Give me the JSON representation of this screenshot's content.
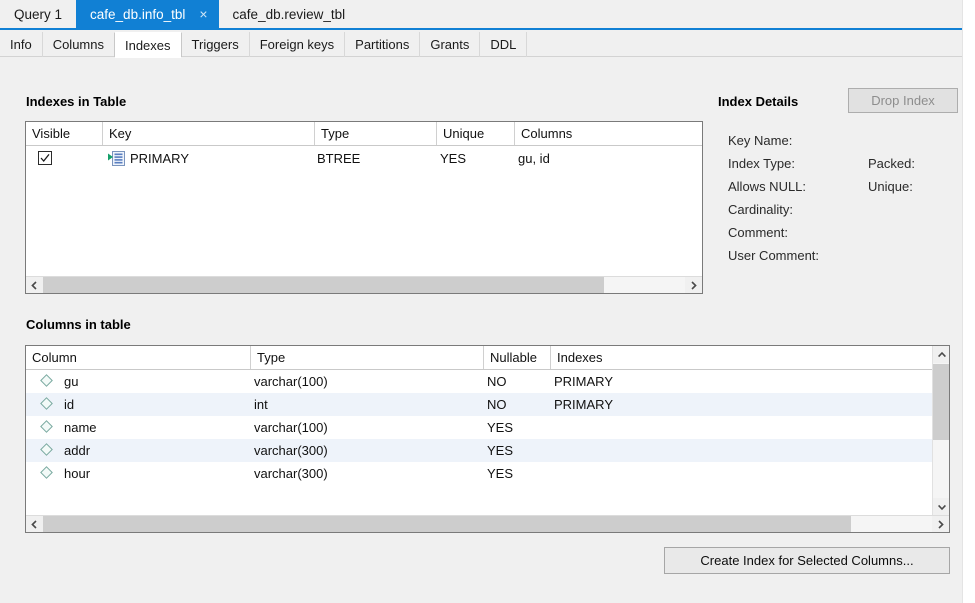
{
  "editor_tabs": [
    {
      "label": "Query 1",
      "active": false,
      "closable": false
    },
    {
      "label": "cafe_db.info_tbl",
      "active": true,
      "closable": true,
      "close_glyph": "×"
    },
    {
      "label": "cafe_db.review_tbl",
      "active": false,
      "closable": false
    }
  ],
  "object_tabs": [
    {
      "label": "Info",
      "active": false
    },
    {
      "label": "Columns",
      "active": false
    },
    {
      "label": "Indexes",
      "active": true
    },
    {
      "label": "Triggers",
      "active": false
    },
    {
      "label": "Foreign keys",
      "active": false
    },
    {
      "label": "Partitions",
      "active": false
    },
    {
      "label": "Grants",
      "active": false
    },
    {
      "label": "DDL",
      "active": false
    }
  ],
  "indexes_section": {
    "title": "Indexes in Table",
    "headers": [
      "Visible",
      "Key",
      "Type",
      "Unique",
      "Columns"
    ],
    "rows": [
      {
        "visible": true,
        "key": "PRIMARY",
        "type": "BTREE",
        "unique": "YES",
        "columns": "gu, id"
      }
    ]
  },
  "index_details": {
    "title": "Index Details",
    "drop_button": "Drop Index",
    "drop_button_enabled": false,
    "fields": [
      {
        "label": "Key Name:",
        "value": "",
        "second_label": "",
        "second_value": ""
      },
      {
        "label": "Index Type:",
        "value": "",
        "second_label": "Packed:",
        "second_value": ""
      },
      {
        "label": "Allows NULL:",
        "value": "",
        "second_label": "Unique:",
        "second_value": ""
      },
      {
        "label": "Cardinality:",
        "value": "",
        "second_label": "",
        "second_value": ""
      },
      {
        "label": "Comment:",
        "value": "",
        "second_label": "",
        "second_value": ""
      },
      {
        "label": "User Comment:",
        "value": "",
        "second_label": "",
        "second_value": ""
      }
    ]
  },
  "columns_section": {
    "title": "Columns in table",
    "headers": [
      "Column",
      "Type",
      "Nullable",
      "Indexes"
    ],
    "rows": [
      {
        "column": "gu",
        "type": "varchar(100)",
        "nullable": "NO",
        "indexes": "PRIMARY"
      },
      {
        "column": "id",
        "type": "int",
        "nullable": "NO",
        "indexes": "PRIMARY"
      },
      {
        "column": "name",
        "type": "varchar(100)",
        "nullable": "YES",
        "indexes": ""
      },
      {
        "column": "addr",
        "type": "varchar(300)",
        "nullable": "YES",
        "indexes": ""
      },
      {
        "column": "hour",
        "type": "varchar(300)",
        "nullable": "YES",
        "indexes": ""
      }
    ]
  },
  "footer": {
    "create_index_button": "Create Index for Selected Columns..."
  },
  "colors": {
    "active_tab_blue": "#1180d4",
    "alt_row": "#eef3fa",
    "panel_border": "#7a7a7a",
    "background": "#f0f0f0",
    "diamond_icon": "#79a9a0",
    "index_icon_green": "#2aa36b",
    "index_icon_blue": "#6a8fc8"
  }
}
